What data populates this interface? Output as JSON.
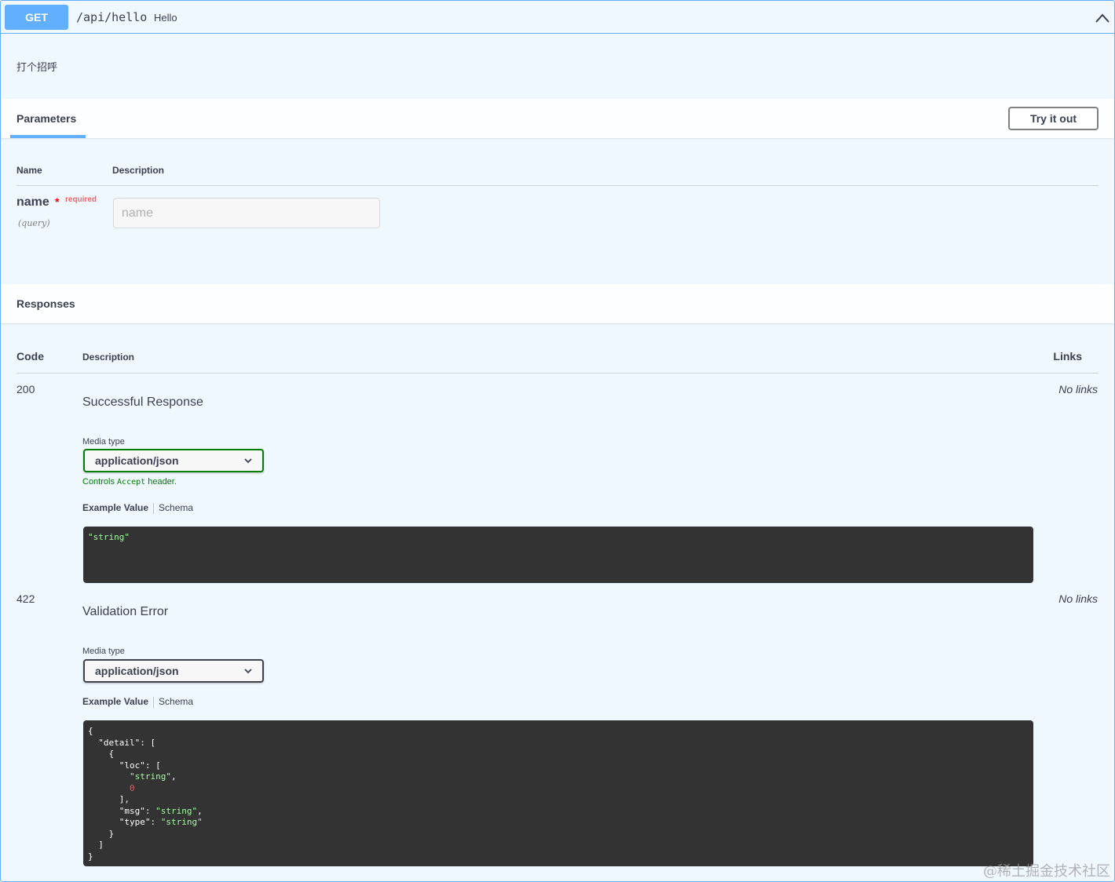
{
  "summary": {
    "method": "GET",
    "path": "/api/hello",
    "description": "Hello"
  },
  "operation": {
    "description": "打个招呼"
  },
  "parameters": {
    "tab_label": "Parameters",
    "try_it_out": "Try it out",
    "columns": {
      "name": "Name",
      "description": "Description"
    },
    "items": [
      {
        "name": "name",
        "required_star": "*",
        "required_label": "required",
        "in": "(query)",
        "placeholder": "name",
        "value": ""
      }
    ]
  },
  "responses": {
    "title": "Responses",
    "columns": {
      "code": "Code",
      "description": "Description",
      "links": "Links"
    },
    "items": [
      {
        "code": "200",
        "description": "Successful Response",
        "links": "No links",
        "media_type_label": "Media type",
        "media_type": "application/json",
        "controls_prefix": "Controls ",
        "controls_code": "Accept",
        "controls_suffix": " header.",
        "tab_example": "Example Value",
        "tab_schema": "Schema",
        "example_string": "\"string\""
      },
      {
        "code": "422",
        "description": "Validation Error",
        "links": "No links",
        "media_type_label": "Media type",
        "media_type": "application/json",
        "tab_example": "Example Value",
        "tab_schema": "Schema",
        "example_lines": [
          "{",
          "  \"detail\": [",
          "    {",
          "      \"loc\": [",
          "        \"string\",",
          "        0",
          "      ],",
          "      \"msg\": \"string\",",
          "      \"type\": \"string\"",
          "    }",
          "  ]",
          "}"
        ]
      }
    ]
  },
  "watermark": "@稀土掘金技术社区",
  "colors": {
    "get": "#61affe",
    "json_string": "#a2fca2",
    "json_number": "#d36363",
    "code_bg": "#333333",
    "green": "#008000"
  },
  "icons": {
    "collapse": "chevron-up-icon",
    "select": "chevron-down-icon"
  }
}
